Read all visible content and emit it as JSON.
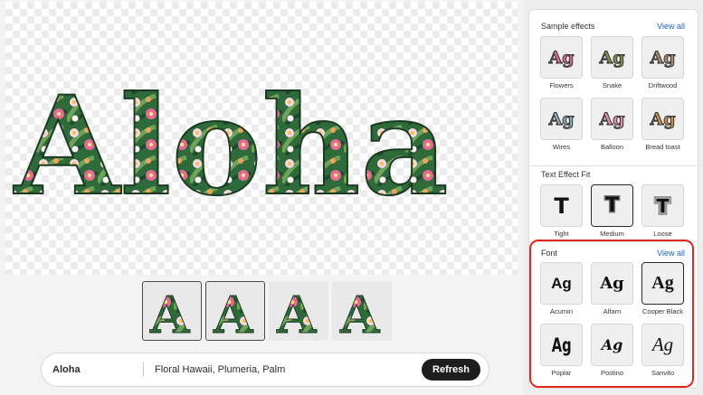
{
  "canvas": {
    "word": "Aloha",
    "thumbnail_letters": [
      "A",
      "A",
      "A",
      "A"
    ],
    "selected_thumbnail": 1
  },
  "prompt": {
    "text": "Aloha",
    "style": "Floral Hawaii, Plumeria, Palm",
    "refresh_label": "Refresh"
  },
  "sample_effects": {
    "title": "Sample effects",
    "view_all": "View all",
    "sample_text": "Ag",
    "items": [
      {
        "label": "Flowers",
        "color": "#d56a8e"
      },
      {
        "label": "Snake",
        "color": "#7f8f52"
      },
      {
        "label": "Driftwood",
        "color": "#a88a6a"
      },
      {
        "label": "Wires",
        "color": "#8aa7b8"
      },
      {
        "label": "Balloon",
        "color": "#e58ea5"
      },
      {
        "label": "Bread toast",
        "color": "#c98a4a"
      }
    ]
  },
  "text_effect_fit": {
    "title": "Text Effect Fit",
    "letter": "T",
    "items": [
      {
        "label": "Tight",
        "selected": false
      },
      {
        "label": "Medium",
        "selected": true
      },
      {
        "label": "Loose",
        "selected": false
      }
    ]
  },
  "font": {
    "title": "Font",
    "view_all": "View all",
    "sample_text": "Ag",
    "items": [
      {
        "label": "Acumin",
        "selected": false
      },
      {
        "label": "Alfarn",
        "selected": false
      },
      {
        "label": "Cooper Black",
        "selected": true
      },
      {
        "label": "Poplar",
        "selected": false
      },
      {
        "label": "Postino",
        "selected": false
      },
      {
        "label": "Sanvito",
        "selected": false
      }
    ]
  },
  "colors": {
    "highlight": "#e0281e",
    "link": "#1564c0",
    "refresh_button": "#1e1e1e",
    "floral_green": "#2f6b3a",
    "floral_pink": "#e56a92",
    "floral_yellow": "#f2c14e"
  }
}
